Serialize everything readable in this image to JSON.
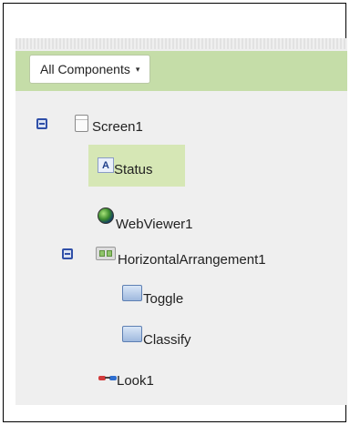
{
  "toolbar": {
    "dropdown_label": "All Components",
    "dropdown_caret": "▾"
  },
  "tree": {
    "screen": {
      "label": "Screen1",
      "icon": "screen-icon",
      "toggle": "collapse"
    },
    "status": {
      "label": "Status",
      "icon": "label-icon",
      "icon_glyph": "A",
      "selected": true
    },
    "webviewer": {
      "label": "WebViewer1",
      "icon": "globe-icon"
    },
    "harr": {
      "label": "HorizontalArrangement1",
      "icon": "horizontal-arrangement-icon",
      "toggle": "collapse"
    },
    "toggle_btn": {
      "label": "Toggle",
      "icon": "button-icon"
    },
    "classify_btn": {
      "label": "Classify",
      "icon": "button-icon"
    },
    "look": {
      "label": "Look1",
      "icon": "look-extension-icon"
    }
  },
  "colors": {
    "toolbar_bg": "#c5dda8",
    "selection_bg": "#d6e7b5",
    "panel_bg": "#efefef",
    "toggle_blue": "#2f4fa8"
  }
}
